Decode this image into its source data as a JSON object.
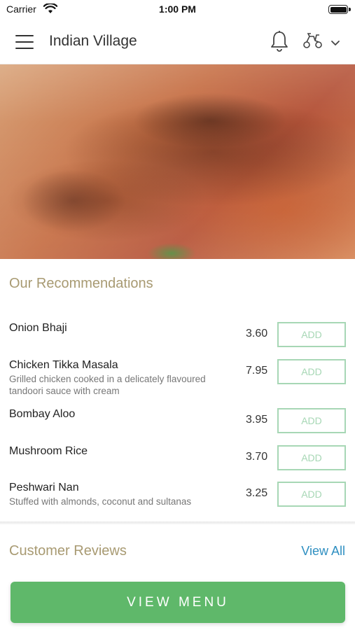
{
  "status_bar": {
    "carrier": "Carrier",
    "time": "1:00 PM"
  },
  "header": {
    "title": "Indian Village",
    "icons": [
      "menu-icon",
      "bell-icon",
      "scooter-icon",
      "chevron-down-icon"
    ]
  },
  "hero": {
    "image": "tandoori chicken photo"
  },
  "recommendations": {
    "title": "Our Recommendations",
    "items": [
      {
        "name": "Onion Bhaji",
        "description": "",
        "price": "3.60",
        "button": "ADD"
      },
      {
        "name": "Chicken Tikka Masala",
        "description": "Grilled chicken cooked in a delicately flavoured tandoori sauce with cream",
        "price": "7.95",
        "button": "ADD"
      },
      {
        "name": "Bombay Aloo",
        "description": "",
        "price": "3.95",
        "button": "ADD"
      },
      {
        "name": "Mushroom Rice",
        "description": "",
        "price": "3.70",
        "button": "ADD"
      },
      {
        "name": "Peshwari Nan",
        "description": "Stuffed with almonds, coconut and sultanas",
        "price": "3.25",
        "button": "ADD"
      }
    ]
  },
  "reviews": {
    "title": "Customer Reviews",
    "view_all": "View All"
  },
  "footer": {
    "view_menu": "VIEW MENU"
  },
  "colors": {
    "accent_green": "#5fb86a",
    "add_border": "#a7d7b5",
    "section_title": "#a89a72",
    "link_blue": "#2f8fc1"
  }
}
